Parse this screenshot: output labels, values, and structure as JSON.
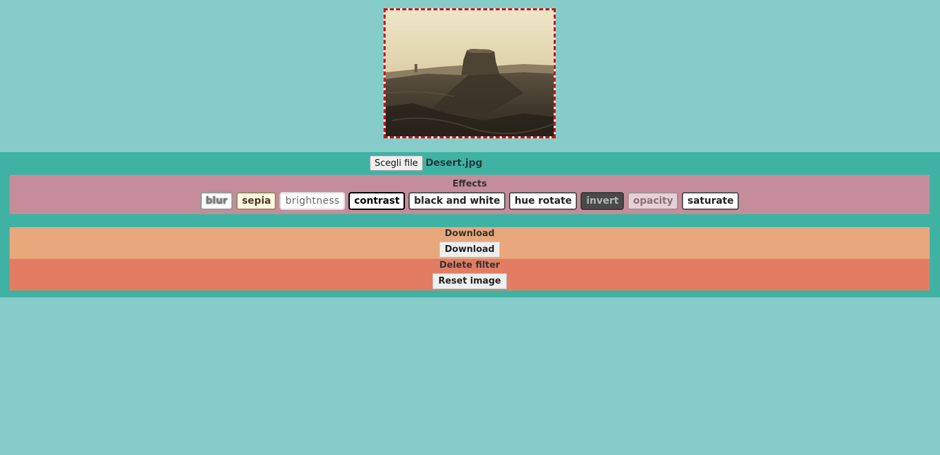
{
  "preview": {
    "image_label": "desert-landscape-photo"
  },
  "file_picker": {
    "button_label": "Scegli file",
    "file_name": "Desert.jpg"
  },
  "effects": {
    "title": "Effects",
    "buttons": {
      "blur": "blur",
      "sepia": "sepia",
      "brightness": "brightness",
      "contrast": "contrast",
      "black_and_white": "black and white",
      "hue_rotate": "hue rotate",
      "invert": "invert",
      "opacity": "opacity",
      "saturate": "saturate"
    }
  },
  "download": {
    "title": "Download",
    "button_label": "Download"
  },
  "delete_filter": {
    "title": "Delete filter",
    "button_label": "Reset image"
  },
  "colors": {
    "page_bg": "#86cdca",
    "controls_bg": "#40b2a3",
    "effects_bg": "#c58d9a",
    "download_bg": "#e8a87c",
    "delete_bg": "#e27d64",
    "preview_border": "#d01010"
  }
}
